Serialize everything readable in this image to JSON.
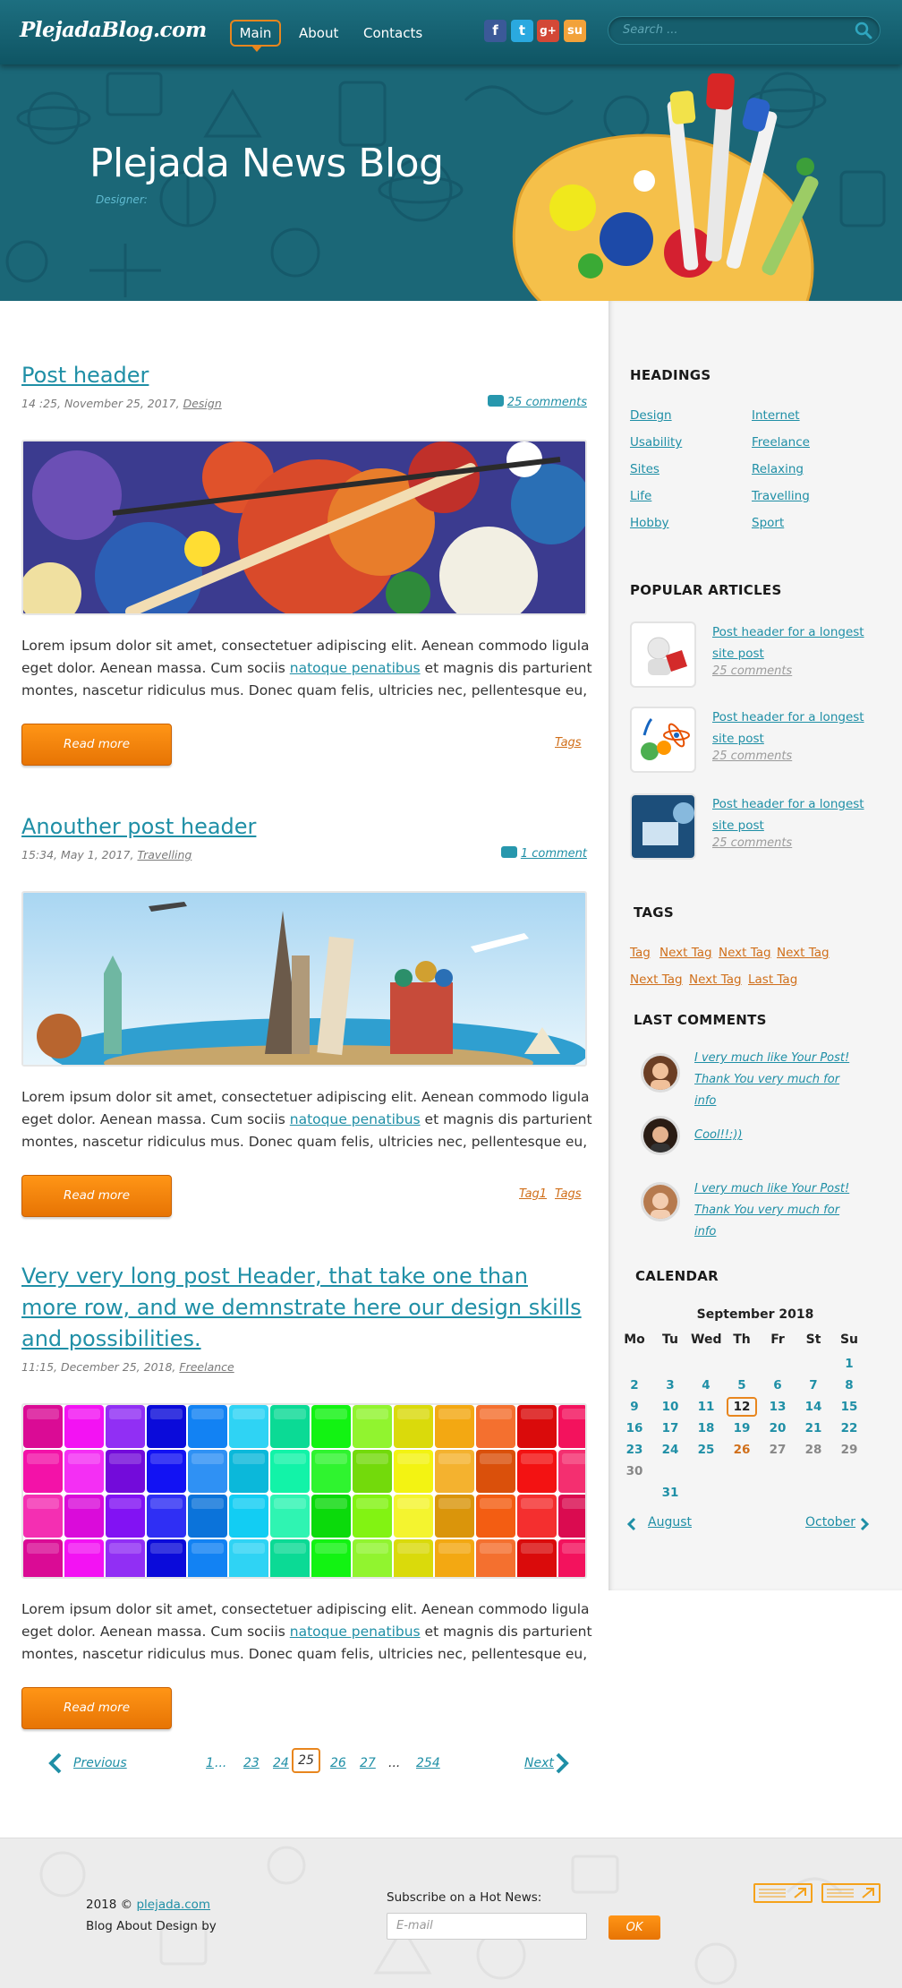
{
  "header": {
    "logo": "PlejadaBlog.com",
    "nav": [
      "Main",
      "About",
      "Contacts"
    ],
    "social": [
      {
        "name": "facebook-icon",
        "glyph": "f"
      },
      {
        "name": "twitter-icon",
        "glyph": "t"
      },
      {
        "name": "google-plus-icon",
        "glyph": "g+"
      },
      {
        "name": "stumbleupon-icon",
        "glyph": "su"
      }
    ],
    "search_placeholder": "Search ..."
  },
  "hero": {
    "title": "Plejada News Blog",
    "subtitle": "Designer:"
  },
  "posts": [
    {
      "title": "Post header",
      "meta_time": "14 :25, November 25, 2017,",
      "meta_cat": "Design",
      "comments": "25 comments",
      "text_a": "Lorem ipsum dolor sit amet, consectetuer adipiscing elit. Aenean commodo ligula eget dolor. Aenean massa. Cum sociis ",
      "text_link": "natoque penatibus",
      "text_b": " et magnis dis parturient montes, nascetur ridiculus mus. Donec quam felis, ultricies nec, pellentesque eu,",
      "read_more": "Read more",
      "tags": [
        "Tags"
      ]
    },
    {
      "title": "Anouther post header",
      "meta_time": "15:34, May 1, 2017,",
      "meta_cat": "Travelling",
      "comments": "1 comment",
      "text_a": "Lorem ipsum dolor sit amet, consectetuer adipiscing elit. Aenean commodo ligula eget dolor. Aenean massa. Cum sociis ",
      "text_link": "natoque penatibus",
      "text_b": " et magnis dis parturient montes, nascetur ridiculus mus. Donec quam felis, ultricies nec, pellentesque eu,",
      "read_more": "Read more",
      "tags": [
        "Tag1",
        "Tags"
      ]
    },
    {
      "title": "Very very long post Header, that take one than more row, and we demnstrate here our design skills and possibilities.",
      "meta_time": "11:15, December 25, 2018,",
      "meta_cat": "Freelance",
      "text_a": "Lorem ipsum dolor sit amet, consectetuer adipiscing elit. Aenean commodo ligula eget dolor. Aenean massa. Cum sociis ",
      "text_link": "natoque penatibus",
      "text_b": " et magnis dis parturient montes, nascetur ridiculus mus. Donec quam felis, ultricies nec, pellentesque eu,",
      "read_more": "Read more"
    }
  ],
  "pagination": {
    "previous": "Previous",
    "pages": [
      "1",
      "...",
      "23",
      "24",
      "25",
      "26",
      "27",
      "...",
      "254"
    ],
    "current": "25",
    "next": "Next"
  },
  "sidebar": {
    "headings_title": "HEADINGS",
    "headings": [
      "Design",
      "Internet",
      "Usability",
      "Freelance",
      "Sites",
      "Relaxing",
      "Life",
      "Travelling",
      "Hobby",
      "Sport"
    ],
    "popular_title": "POPULAR ARTICLES",
    "popular": [
      {
        "title": "Post header for a longest site post",
        "comments": "25 comments"
      },
      {
        "title": "Post header for a longest site post",
        "comments": "25 comments"
      },
      {
        "title": "Post header for a longest site post",
        "comments": "25 comments"
      }
    ],
    "tags_title": "TAGS",
    "tags": [
      "Tag",
      "Next Tag",
      "Next Tag",
      "Next Tag",
      "Next Tag",
      "Next Tag",
      "Last Tag"
    ],
    "last_comments_title": "LAST COMMENTS",
    "last_comments": [
      "I very much like Your Post! Thank You very much for info",
      "Cool!!:))",
      "I very much like Your Post! Thank You very much for info"
    ],
    "calendar_title": "CALENDAR",
    "calendar": {
      "month": "September 2018",
      "dow": [
        "Mo",
        "Tu",
        "Wed",
        "Th",
        "Fr",
        "St",
        "Su"
      ],
      "today": "12",
      "prev": "August",
      "next": "October"
    }
  },
  "footer": {
    "copyright": "2018 ©",
    "site_link": "plejada.com",
    "tagline": "Blog About Design by",
    "subscribe_label": "Subscribe on a Hot News:",
    "email_placeholder": "E-mail",
    "ok": "OK"
  },
  "colors": {
    "accent": "#1f8fa6",
    "orange": "#f07f0a",
    "header": "#135a69"
  }
}
